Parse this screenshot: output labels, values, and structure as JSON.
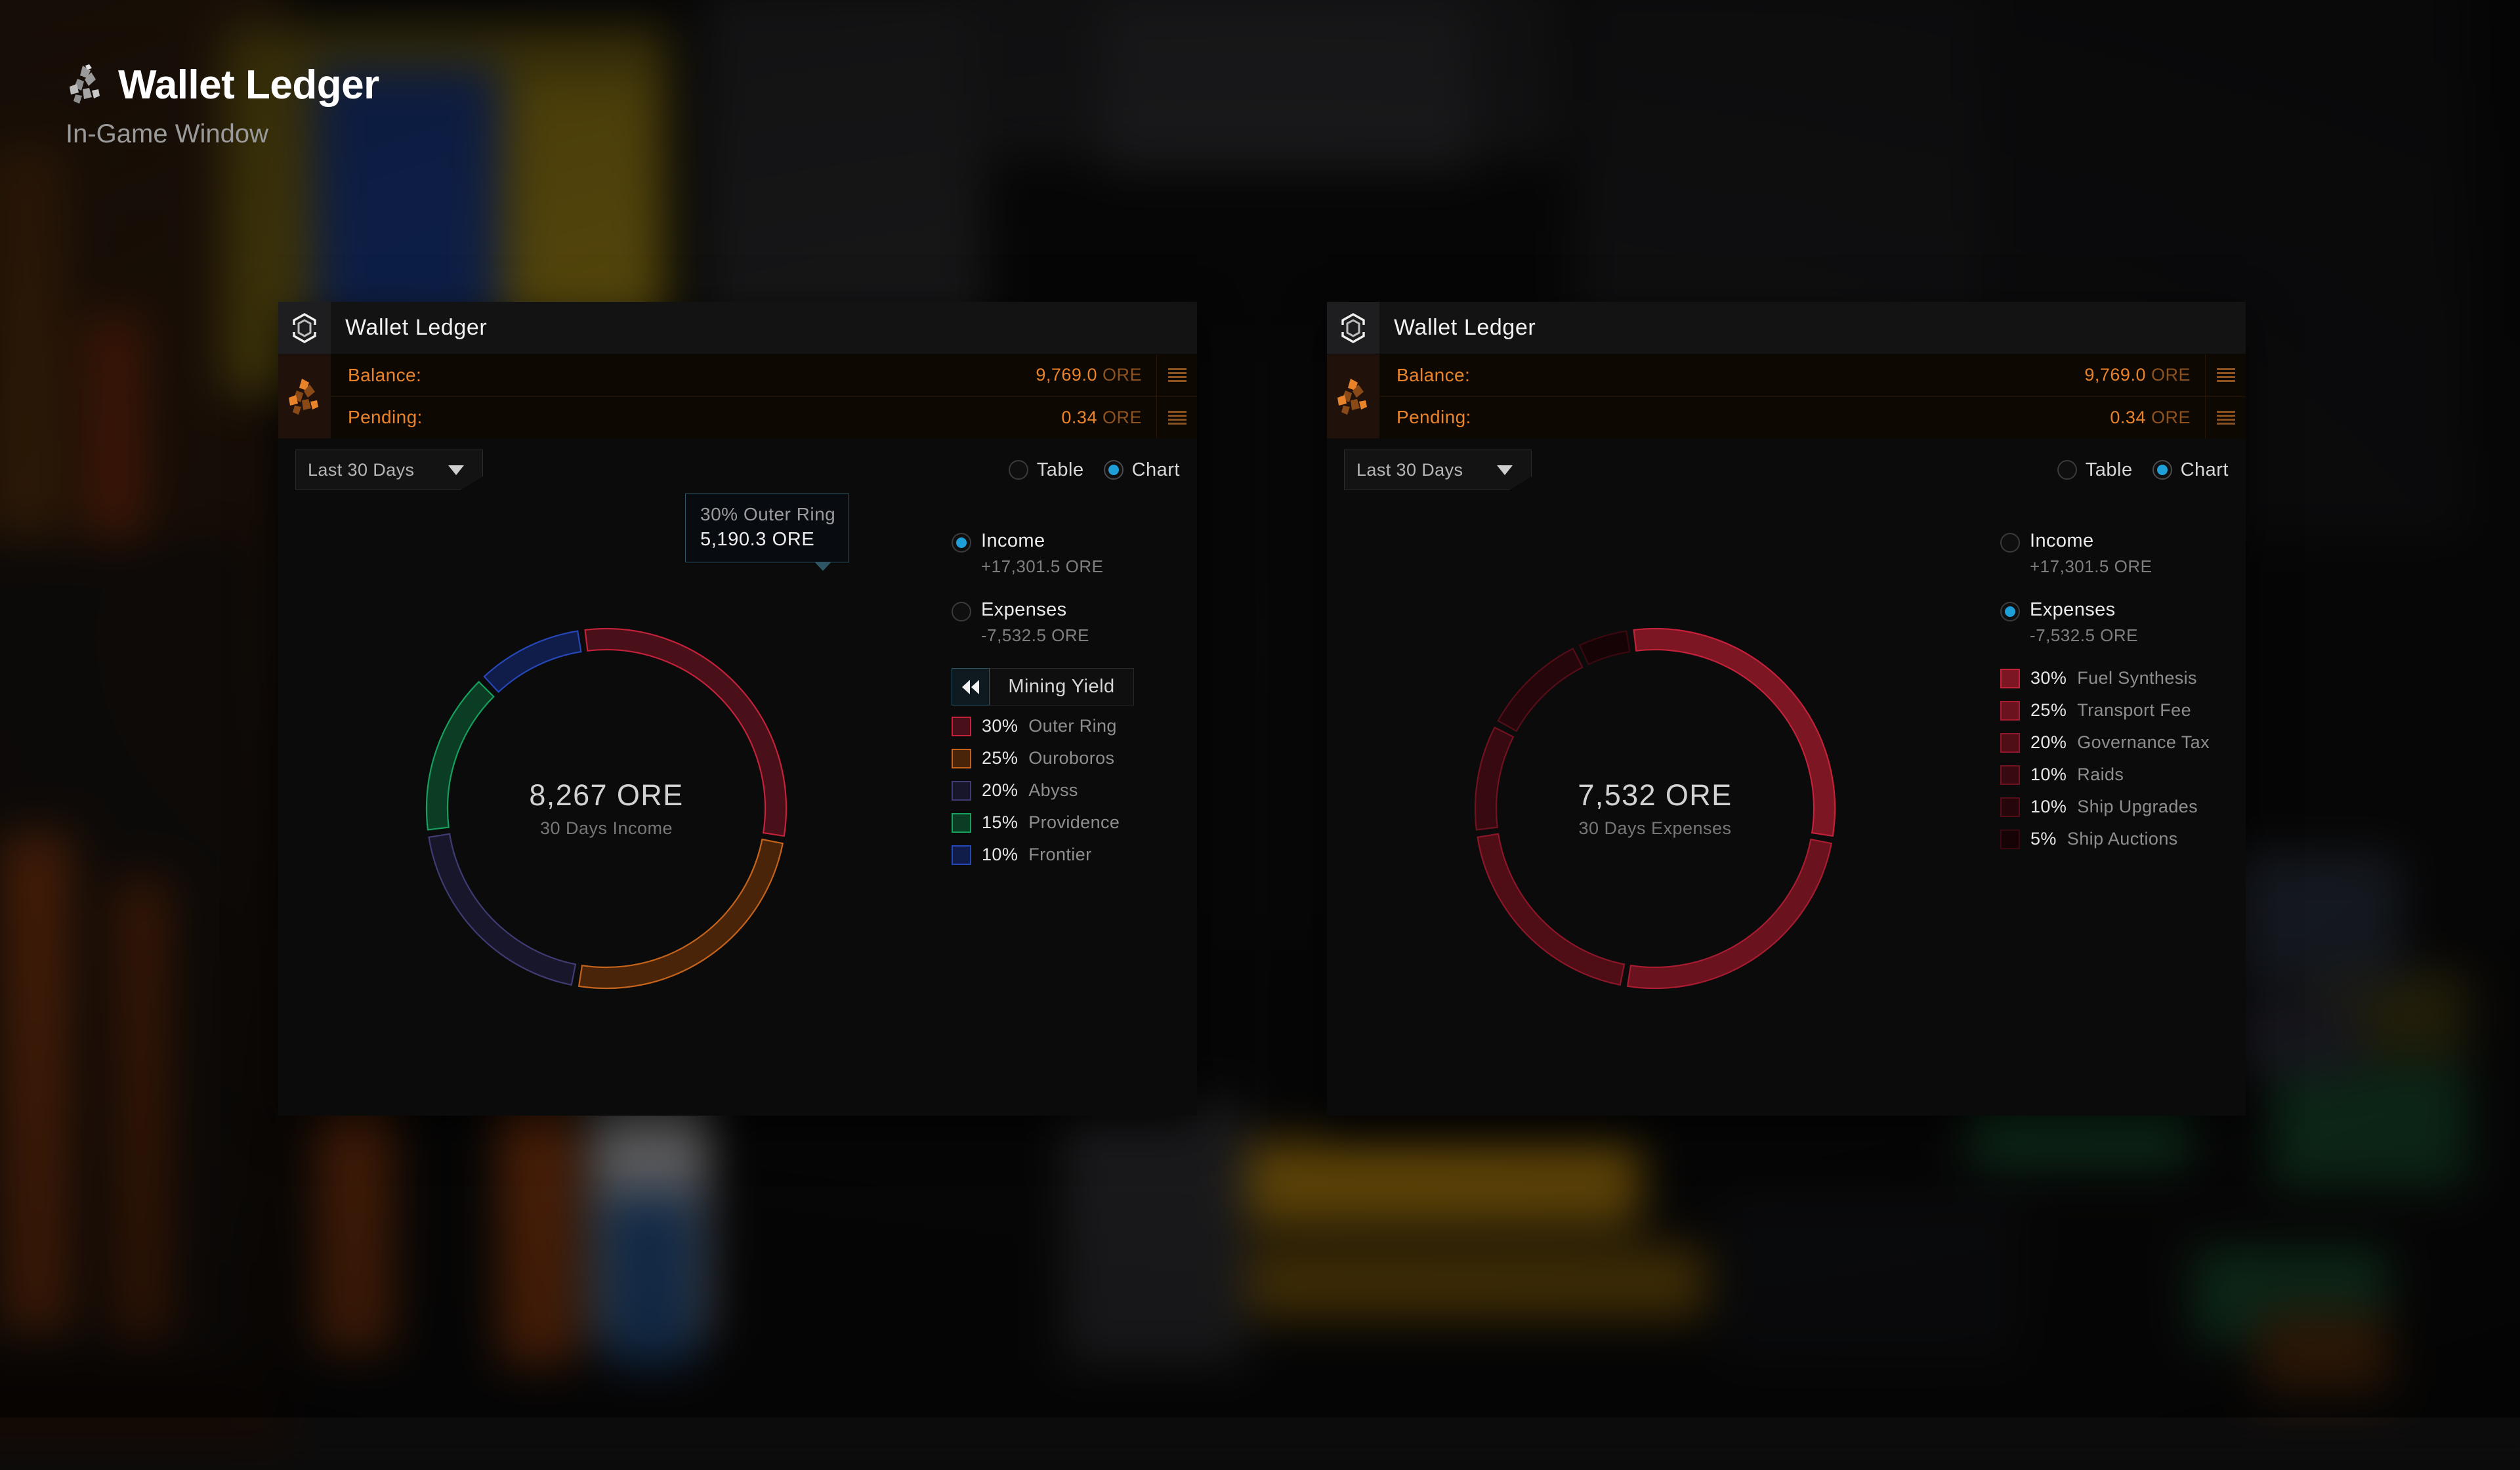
{
  "page": {
    "title": "Wallet Ledger",
    "subtitle": "In-Game Window",
    "logo_icon": "ore-crystal-icon"
  },
  "currency": "ORE",
  "accent": {
    "blue": "#1f9fd8",
    "orange": "#e8832a",
    "teal_border": "#2d5564"
  },
  "panels": [
    {
      "id": "income-panel",
      "titlebar": {
        "title": "Wallet Ledger",
        "icon": "hexagon-ring-icon"
      },
      "balance": {
        "icon": "ore-crystal-icon",
        "rows": [
          {
            "label": "Balance:",
            "value": "9,769.0",
            "unit": "ORE",
            "menu_icon": "hamburger-menu-icon"
          },
          {
            "label": "Pending:",
            "value": "0.34",
            "unit": "ORE",
            "menu_icon": "hamburger-menu-icon"
          }
        ]
      },
      "controls": {
        "range_value": "Last 30 Days",
        "range_options": [
          "Last 30 Days"
        ],
        "view_modes": [
          {
            "label": "Table",
            "selected": false
          },
          {
            "label": "Chart",
            "selected": true
          }
        ]
      },
      "center": {
        "amount": "8,267 ORE",
        "caption": "30 Days Income"
      },
      "tooltip": {
        "visible": true,
        "line1": "30% Outer Ring",
        "line2": "5,190.3 ORE"
      },
      "sources": [
        {
          "label": "Income",
          "value": "+17,301.5 ORE",
          "selected": true
        },
        {
          "label": "Expenses",
          "value": "-7,532.5 ORE",
          "selected": false
        }
      ],
      "back_button": {
        "label": "Mining Yield",
        "icon": "rewind-double-left-icon"
      },
      "chart_data": {
        "type": "pie",
        "title": "30 Days Income",
        "total": 8267,
        "total_label": "8,267 ORE",
        "categories": [
          "Outer Ring",
          "Ouroboros",
          "Abyss",
          "Providence",
          "Frontier"
        ],
        "values": [
          30,
          25,
          20,
          15,
          10
        ],
        "labels": [
          "30% Outer Ring",
          "25% Ouroboros",
          "20% Abyss",
          "15% Providence",
          "10% Frontier"
        ],
        "colors": [
          "#c4213a",
          "#c4631b",
          "#3f3c73",
          "#16a05e",
          "#2647b8"
        ],
        "fills": [
          "#4a1019",
          "#4a2408",
          "#17162b",
          "#0a3d24",
          "#101d4a"
        ],
        "donut": true,
        "legend": "right"
      }
    },
    {
      "id": "expenses-panel",
      "titlebar": {
        "title": "Wallet Ledger",
        "icon": "hexagon-ring-icon"
      },
      "balance": {
        "icon": "ore-crystal-icon",
        "rows": [
          {
            "label": "Balance:",
            "value": "9,769.0",
            "unit": "ORE",
            "menu_icon": "hamburger-menu-icon"
          },
          {
            "label": "Pending:",
            "value": "0.34",
            "unit": "ORE",
            "menu_icon": "hamburger-menu-icon"
          }
        ]
      },
      "controls": {
        "range_value": "Last 30 Days",
        "range_options": [
          "Last 30 Days"
        ],
        "view_modes": [
          {
            "label": "Table",
            "selected": false
          },
          {
            "label": "Chart",
            "selected": true
          }
        ]
      },
      "center": {
        "amount": "7,532 ORE",
        "caption": "30 Days Expenses"
      },
      "tooltip": {
        "visible": false,
        "line1": "",
        "line2": ""
      },
      "sources": [
        {
          "label": "Income",
          "value": "+17,301.5 ORE",
          "selected": false
        },
        {
          "label": "Expenses",
          "value": "-7,532.5 ORE",
          "selected": true
        }
      ],
      "chart_data": {
        "type": "pie",
        "title": "30 Days Expenses",
        "total": 7532,
        "total_label": "7,532 ORE",
        "categories": [
          "Fuel Synthesis",
          "Transport Fee",
          "Governance Tax",
          "Raids",
          "Ship Upgrades",
          "Ship Auctions"
        ],
        "values": [
          30,
          25,
          20,
          10,
          10,
          5
        ],
        "labels": [
          "30% Fuel Synthesis",
          "25% Transport Fee",
          "20% Governance Tax",
          "10% Raids",
          "10% Ship Upgrades",
          "5% Ship Auctions"
        ],
        "colors": [
          "#c4213a",
          "#a81c31",
          "#8d1728",
          "#71121f",
          "#560d17",
          "#3a090f"
        ],
        "fills": [
          "#7c1622",
          "#6a121d",
          "#4f0d16",
          "#370910",
          "#24060b",
          "#160306"
        ],
        "donut": true,
        "legend": "right"
      }
    }
  ]
}
